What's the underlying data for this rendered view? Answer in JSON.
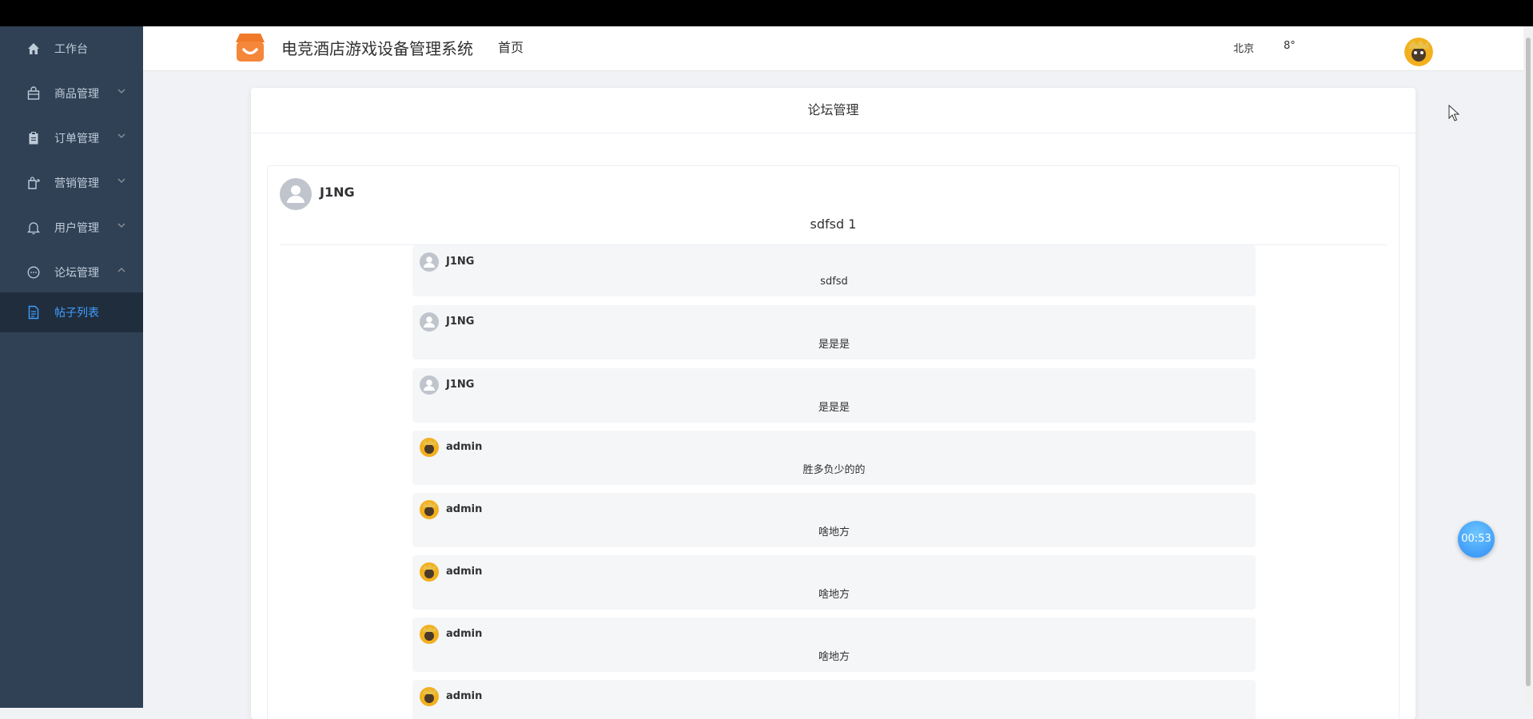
{
  "sidebar": {
    "items": [
      {
        "label": "工作台",
        "icon": "home-icon"
      },
      {
        "label": "商品管理",
        "icon": "bag-icon"
      },
      {
        "label": "订单管理",
        "icon": "clipboard-icon"
      },
      {
        "label": "营销管理",
        "icon": "shopping-icon"
      },
      {
        "label": "用户管理",
        "icon": "bell-icon"
      },
      {
        "label": "论坛管理",
        "icon": "chat-icon"
      },
      {
        "label": "帖子列表",
        "icon": "document-icon"
      }
    ]
  },
  "header": {
    "system_title": "电竞酒店游戏设备管理系统",
    "home": "首页",
    "city": "北京",
    "temperature": "8°"
  },
  "card": {
    "title": "论坛管理"
  },
  "post": {
    "author": "J1NG",
    "content": "sdfsd 1",
    "replies": [
      {
        "user": "J1NG",
        "text": "sdfsd",
        "avatar": "default-user-icon"
      },
      {
        "user": "J1NG",
        "text": "是是是",
        "avatar": "default-user-icon"
      },
      {
        "user": "J1NG",
        "text": "是是是",
        "avatar": "default-user-icon"
      },
      {
        "user": "admin",
        "text": "胜多负少的的",
        "avatar": "admin-avatar-icon"
      },
      {
        "user": "admin",
        "text": "啥地方",
        "avatar": "admin-avatar-icon"
      },
      {
        "user": "admin",
        "text": "啥地方",
        "avatar": "admin-avatar-icon"
      },
      {
        "user": "admin",
        "text": "啥地方",
        "avatar": "admin-avatar-icon"
      },
      {
        "user": "admin",
        "text": "",
        "avatar": "admin-avatar-icon"
      }
    ]
  },
  "timer": "00:53",
  "colors": {
    "sidebar_bg": "#304156",
    "sidebar_active_bg": "#1f2d3d",
    "active_text": "#409eff",
    "logo_orange": "#f5873a"
  }
}
